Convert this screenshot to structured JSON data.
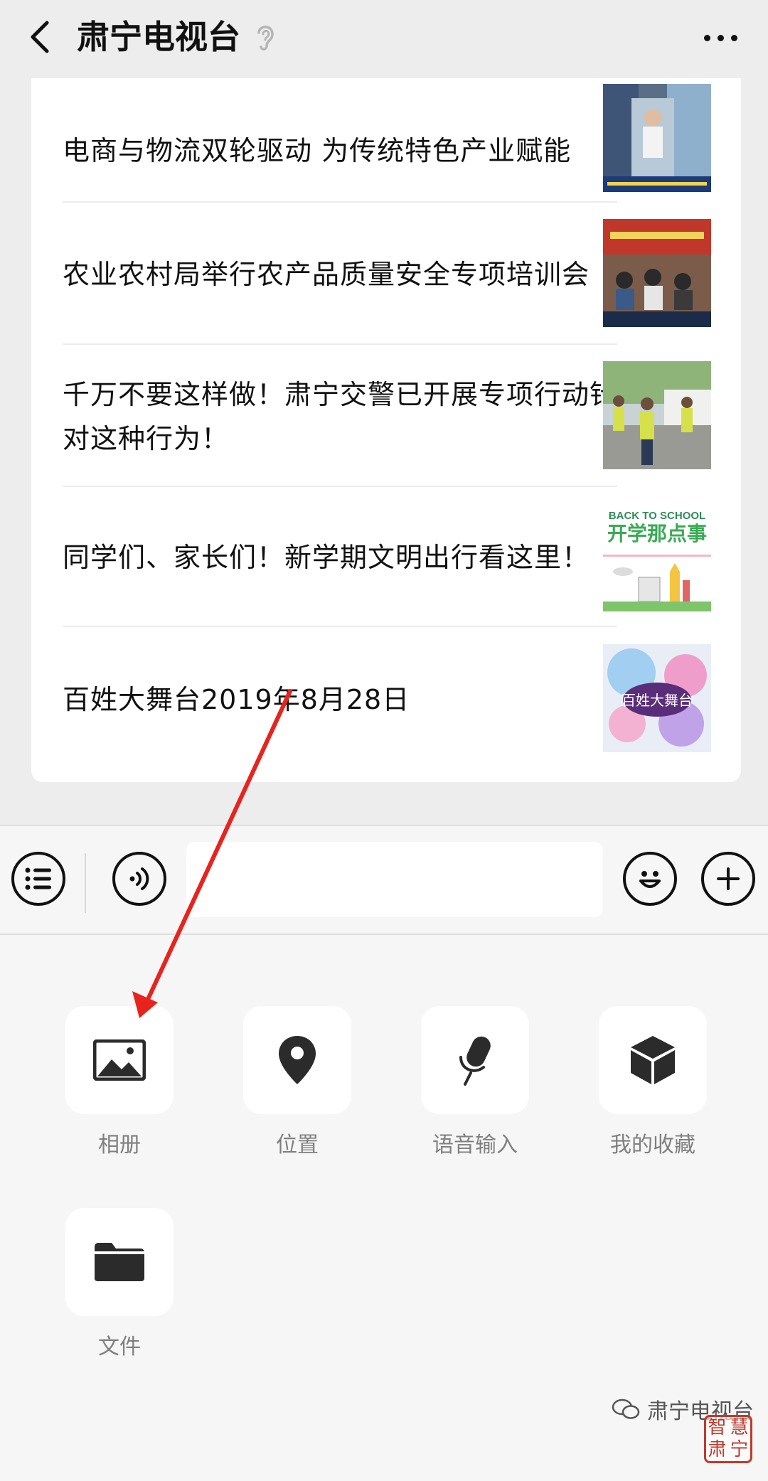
{
  "header": {
    "title": "肃宁电视台"
  },
  "articles": [
    {
      "title": "电商与物流双轮驱动 为传统特色产业赋能",
      "thumb": "electric-commerce-photo"
    },
    {
      "title": "农业农村局举行农产品质量安全专项培训会",
      "thumb": "meeting-photo"
    },
    {
      "title": "千万不要这样做！肃宁交警已开展专项行动针对这种行为！",
      "thumb": "traffic-police-photo"
    },
    {
      "title": "同学们、家长们！新学期文明出行看这里！",
      "thumb": "back-to-school-graphic",
      "thumb_text_1": "BACK TO SCHOOL",
      "thumb_text_2": "开学那点事"
    },
    {
      "title": "百姓大舞台2019年8月28日",
      "thumb": "stage-graphic",
      "thumb_text": "百姓大舞台"
    }
  ],
  "input_bar": {
    "menu_icon": "list-icon",
    "voice_icon": "voice-icon",
    "emoji_icon": "smiley-icon",
    "plus_icon": "plus-icon",
    "placeholder": ""
  },
  "tools": [
    {
      "label": "相册",
      "icon": "image-icon"
    },
    {
      "label": "位置",
      "icon": "location-pin-icon"
    },
    {
      "label": "语音输入",
      "icon": "microphone-icon"
    },
    {
      "label": "我的收藏",
      "icon": "cube-icon"
    },
    {
      "label": "文件",
      "icon": "folder-icon"
    }
  ],
  "watermark": {
    "text": "肃宁电视台",
    "seal": [
      "智",
      "慧",
      "肃",
      "宁"
    ]
  },
  "colors": {
    "background": "#ededed",
    "card": "#ffffff",
    "panel": "#f6f6f6",
    "label_gray": "#7f7f7f",
    "annotation_red": "#e8231d"
  }
}
